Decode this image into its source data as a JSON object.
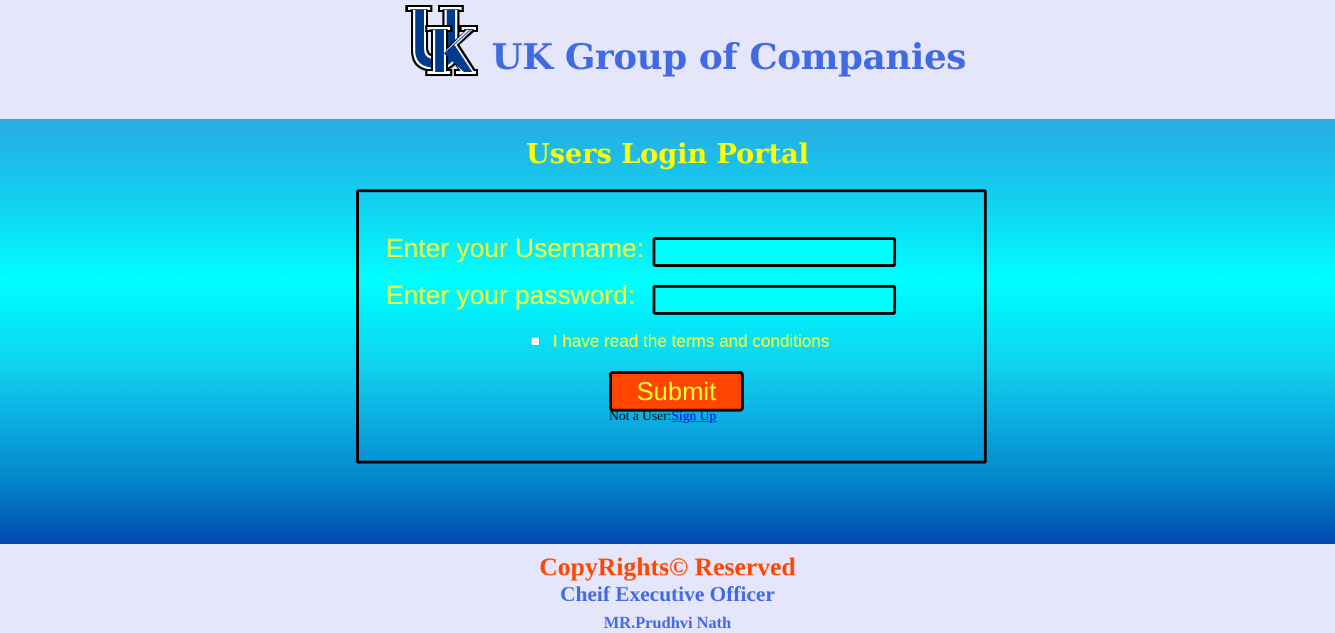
{
  "header": {
    "logo_text": "UK",
    "title": "UK Group of Companies"
  },
  "main": {
    "portal_title": "Users Login Portal",
    "form": {
      "username_label": "Enter your Username:",
      "username_value": "",
      "password_label": "Enter your password:",
      "password_value": "",
      "terms_label": "I have read the terms and conditions",
      "terms_checked": false,
      "submit_label": "Submit",
      "not_user_text": "Not a User:",
      "signup_link_text": "Sign Up"
    }
  },
  "footer": {
    "copyright": "CopyRights© Reserved",
    "ceo_title": "Cheif Executive Officer",
    "ceo_name": "MR.Prudhvi Nath"
  },
  "colors": {
    "page_background": "#e6e6fa",
    "brand_blue": "#4169e1",
    "label_yellow": "#ffff33",
    "input_cyan": "#00ffff",
    "submit_orange": "#ff4500",
    "logo_blue": "#003a8c"
  }
}
